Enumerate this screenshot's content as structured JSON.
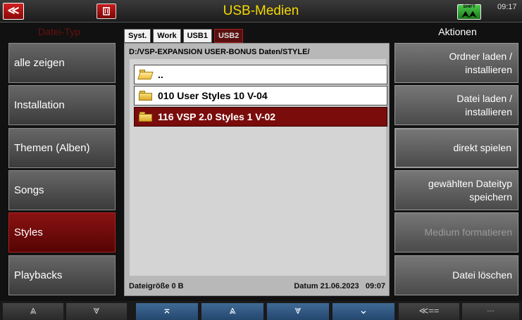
{
  "topbar": {
    "back_icon": "≪",
    "trash_icon": "trash-icon",
    "title": "USB-Medien",
    "shift_label": "SHIFT",
    "shift_icon": "⮝⮝",
    "clock": "09:17"
  },
  "left_panel": {
    "header": "Datei-Typ",
    "items": [
      {
        "label": "alle zeigen",
        "active": false
      },
      {
        "label": "Installation",
        "active": false
      },
      {
        "label": "Themen (Alben)",
        "active": false
      },
      {
        "label": "Songs",
        "active": false
      },
      {
        "label": "Styles",
        "active": true
      },
      {
        "label": "Playbacks",
        "active": false
      }
    ]
  },
  "right_panel": {
    "header": "Aktionen",
    "items": [
      {
        "line1": "Ordner laden /",
        "line2": "installieren",
        "enabled": true
      },
      {
        "line1": "Datei laden /",
        "line2": "installieren",
        "enabled": true
      },
      {
        "line1": "direkt spielen",
        "line2": "",
        "enabled": true
      },
      {
        "line1": "gewählten Dateityp",
        "line2": "speichern",
        "enabled": true
      },
      {
        "line1": "Medium formatieren",
        "line2": "",
        "enabled": false
      },
      {
        "line1": "Datei löschen",
        "line2": "",
        "enabled": true
      }
    ]
  },
  "browser": {
    "tabs": [
      {
        "label": "Syst.",
        "active": false
      },
      {
        "label": "Work",
        "active": false
      },
      {
        "label": "USB1",
        "active": false
      },
      {
        "label": "USB2",
        "active": true
      }
    ],
    "path": "D:/VSP-EXPANSION USER-BONUS Daten/STYLE/",
    "entries": [
      {
        "name": "..",
        "type": "parent",
        "selected": false
      },
      {
        "name": "010 User Styles 10 V-04",
        "type": "folder",
        "selected": false
      },
      {
        "name": "116 VSP 2.0 Styles 1 V-02",
        "type": "folder",
        "selected": true
      }
    ],
    "filesize_label": "Dateigröße 0 B",
    "date_label": "Datum 21.06.2023",
    "time_label": "09:07"
  },
  "bottombar": {
    "buttons": [
      {
        "label": "⩓",
        "name": "left-up-button"
      },
      {
        "label": "⩔",
        "name": "left-down-button"
      },
      {
        "label": "⌅",
        "name": "list-top-button"
      },
      {
        "label": "⩓",
        "name": "list-up-button"
      },
      {
        "label": "⩔",
        "name": "list-down-button"
      },
      {
        "label": "⌄",
        "name": "list-bottom-button"
      },
      {
        "label": "≪==",
        "name": "back-arrow-button"
      },
      {
        "label": "---",
        "name": "empty-button"
      }
    ]
  }
}
